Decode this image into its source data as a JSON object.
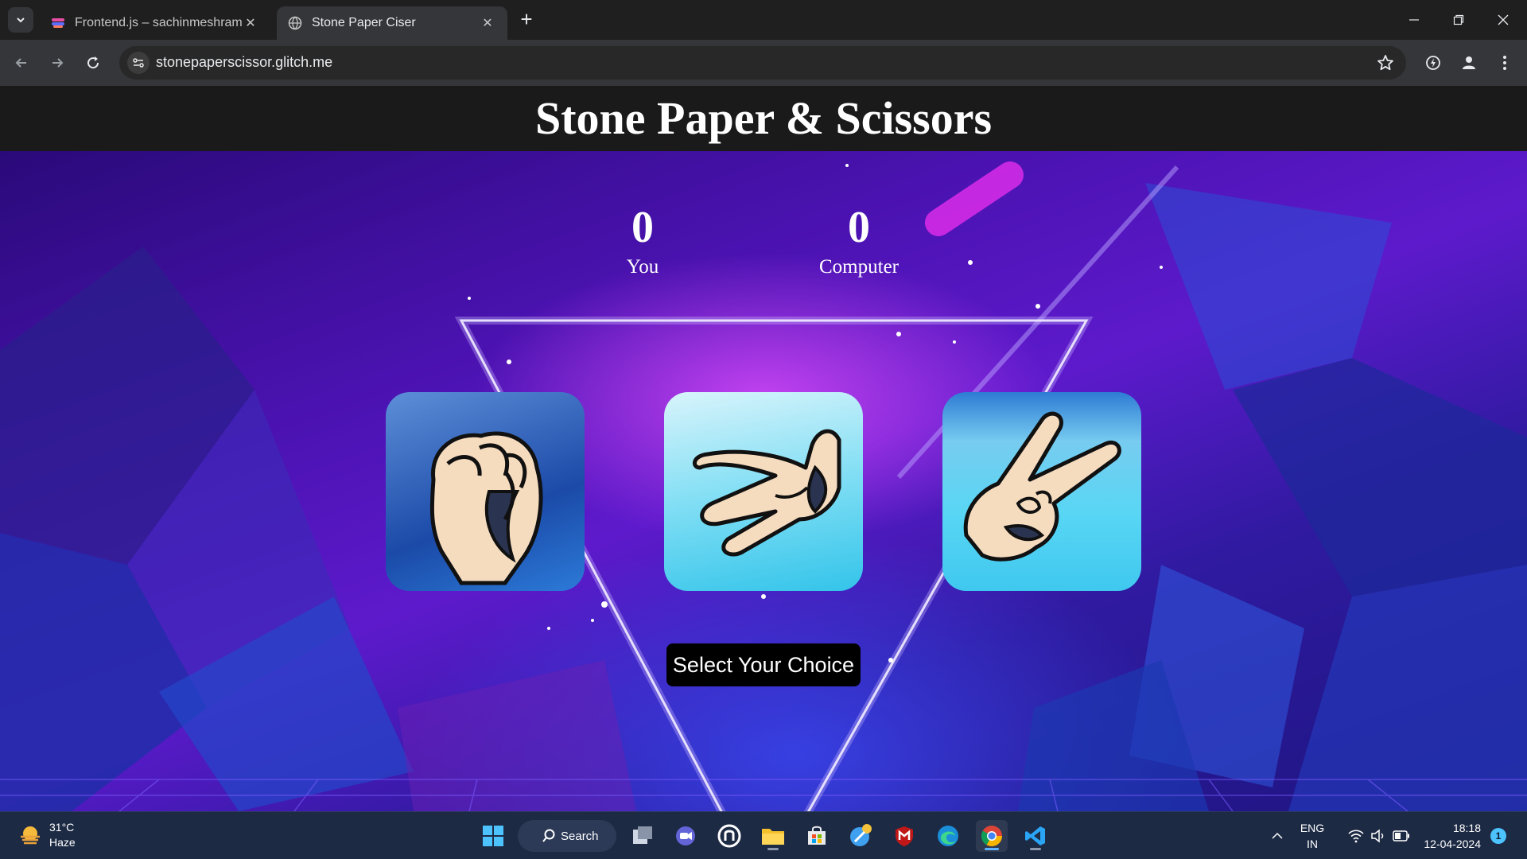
{
  "browser": {
    "tabs": [
      {
        "title": "Frontend.js – sachinmeshrampc",
        "active": false
      },
      {
        "title": "Stone Paper Ciser",
        "active": true
      }
    ],
    "url": "stonepaperscissor.glitch.me"
  },
  "page": {
    "title": "Stone Paper & Scissors",
    "scores": {
      "user": {
        "value": "0",
        "label": "You"
      },
      "computer": {
        "value": "0",
        "label": "Computer"
      }
    },
    "choices": [
      {
        "id": "rock",
        "icon": "fist-hand-icon"
      },
      {
        "id": "paper",
        "icon": "open-hand-icon"
      },
      {
        "id": "scissors",
        "icon": "victory-hand-icon"
      }
    ],
    "message": "Select Your Choice"
  },
  "taskbar": {
    "weather": {
      "temp": "31°C",
      "condition": "Haze"
    },
    "search_label": "Search",
    "language": {
      "line1": "ENG",
      "line2": "IN"
    },
    "clock": {
      "time": "18:18",
      "date": "12-04-2024"
    },
    "notification_count": "1"
  }
}
